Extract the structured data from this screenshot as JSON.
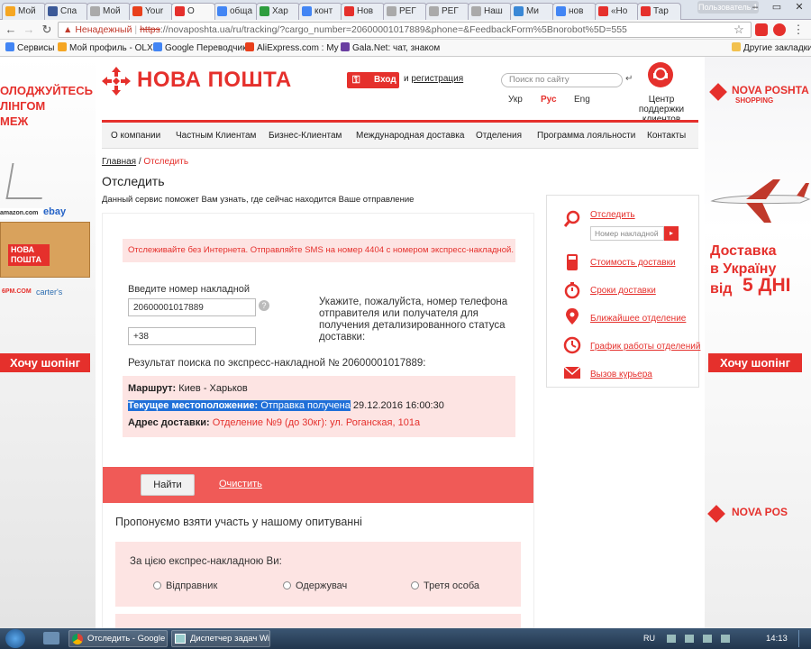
{
  "browser": {
    "tabs": [
      {
        "label": "Мой",
        "color": "#f5a623"
      },
      {
        "label": "Спа",
        "color": "#3b5998"
      },
      {
        "label": "Мой",
        "color": "#aaaaaa"
      },
      {
        "label": "Your",
        "color": "#e8401c"
      },
      {
        "label": "О",
        "color": "#e5302c",
        "active": true
      },
      {
        "label": "обща",
        "color": "#4285f4"
      },
      {
        "label": "Хар",
        "color": "#2e9d3e"
      },
      {
        "label": "конт",
        "color": "#4285f4"
      },
      {
        "label": "Нов",
        "color": "#e5302c"
      },
      {
        "label": "РЕГ",
        "color": "#aaaaaa"
      },
      {
        "label": "РЕГ",
        "color": "#aaaaaa"
      },
      {
        "label": "Наш",
        "color": "#aaaaaa"
      },
      {
        "label": "Ми",
        "color": "#3a88d6"
      },
      {
        "label": "нов",
        "color": "#4285f4"
      },
      {
        "label": "«Но",
        "color": "#e5302c"
      },
      {
        "label": "Тар",
        "color": "#e5302c"
      }
    ],
    "profile": "Пользователь 1",
    "security_label": "Ненадежный",
    "url_scheme": "https",
    "url_rest": "://novaposhta.ua/ru/tracking/?cargo_number=20600001017889&phone=&FeedbackForm%5Bnorobot%5D=555",
    "bookmarks": [
      {
        "label": "Сервисы",
        "color": "#4285f4"
      },
      {
        "label": "Мой профиль - OLX...",
        "color": "#f5a623"
      },
      {
        "label": "Google Переводчик",
        "color": "#4285f4"
      },
      {
        "label": "AliExpress.com : My A",
        "color": "#e8401c"
      },
      {
        "label": "Gala.Net: чат, знаком",
        "color": "#6a3ea1"
      }
    ],
    "other_bookmarks": "Другие закладки"
  },
  "ads": {
    "left_lines": [
      "ОЛОДЖУЙТЕСЬ",
      "ЛІНГОМ",
      "МЕЖ"
    ],
    "left_box": "НОВА ПОШТА",
    "left_brands": [
      "amazon.com",
      "ebay",
      "6PM.COM",
      "carter's"
    ],
    "left_button": "Хочу шопінг",
    "right_logo": "NOVA POSHTA",
    "right_logo_sub": "SHOPPING",
    "right_text_1": "Доставка",
    "right_text_2": "в Україну",
    "right_text_3": "від",
    "right_text_4": "5 ДНІ",
    "right_button": "Хочу шопінг",
    "right_logo_bottom": "NOVA POS"
  },
  "header": {
    "logo": "НОВА ПОШТА",
    "login": "Вход",
    "register_prefix": "и",
    "register": "регистрация",
    "search_placeholder": "Поиск по сайту",
    "langs": [
      "Укр",
      "Рус",
      "Eng"
    ],
    "support_line1": "Центр поддержки",
    "support_line2": "клиентов"
  },
  "nav": [
    "О компании",
    "Частным Клиентам",
    "Бизнес-Клиентам",
    "Международная доставка",
    "Отделения",
    "Программа лояльности",
    "Контакты"
  ],
  "breadcrumb": {
    "home": "Главная",
    "sep": "/",
    "current": "Отследить"
  },
  "title": "Отследить",
  "subtitle": "Данный сервис поможет Вам узнать, где сейчас находится Ваше отправление",
  "form": {
    "notice": "Отслеживайте без Интернета. Отправляйте SMS на номер 4404 с номером экспресс-накладной.",
    "tracking_label": "Введите номер накладной",
    "tracking_value": "20600001017889",
    "phone_value": "+38",
    "help": "?",
    "hint": "Укажите, пожалуйста, номер телефона отправителя или получателя для получения детализированного статуса доставки:",
    "result_title": "Результат поиска по экспресс-накладной № 20600001017889:",
    "route_label": "Маршрут:",
    "route_value": "Киев - Харьков",
    "location_label": "Текущее местоположение:",
    "location_value": "Отправка получена",
    "location_date": "29.12.2016 16:00:30",
    "address_label": "Адрес доставки:",
    "address_value": "Отделение №9 (до 30кг): ул. Роганская, 101а",
    "find": "Найти",
    "clear": "Очистить",
    "survey_title": "Пропонуємо взяти участь у нашому опитуванні",
    "survey_question": "За цією експрес-накладною Ви:",
    "options": [
      "Відправник",
      "Одержувач",
      "Третя особа"
    ]
  },
  "sidebar": {
    "track": "Отследить",
    "input_placeholder": "Номер накладной",
    "go": "▸",
    "items": [
      "Стоимость доставки",
      "Сроки доставки",
      "Ближайшее отделение",
      "График работы отделений",
      "Вызов курьера"
    ]
  },
  "taskbar": {
    "tasks": [
      "Отследить - Google ...",
      "Диспетчер задач Wi..."
    ],
    "lang": "RU",
    "time": "14:13"
  }
}
